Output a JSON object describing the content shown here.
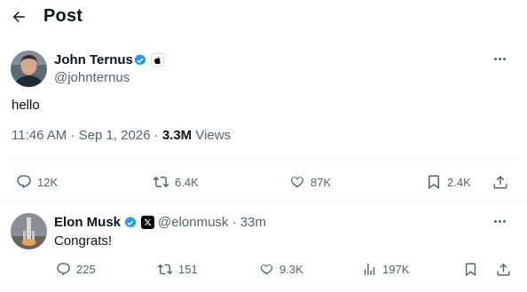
{
  "header": {
    "title": "Post"
  },
  "post": {
    "author_name": "John Ternus",
    "handle": "@johnternus",
    "text": "hello",
    "timestamp": "11:46 AM · Sep 1, 2026 · ",
    "views_count": "3.3M",
    "views_label": " Views",
    "replies": "12K",
    "reposts": "6.4K",
    "likes": "87K",
    "bookmarks": "2.4K"
  },
  "reply": {
    "author_name": "Elon Musk",
    "handle_time": "@elonmusk · 33m",
    "text": "Congrats!",
    "replies": "225",
    "reposts": "151",
    "likes": "9.3K",
    "views": "197K"
  },
  "colors": {
    "verified": "#1d9bf0",
    "muted": "#536471",
    "text": "#0f1419",
    "divider": "#eff3f4"
  },
  "icons": [
    "back-arrow-icon",
    "verified-badge-icon",
    "apple-icon",
    "x-logo-icon",
    "more-icon",
    "reply-icon",
    "repost-icon",
    "like-icon",
    "bookmark-icon",
    "share-icon",
    "views-icon"
  ]
}
